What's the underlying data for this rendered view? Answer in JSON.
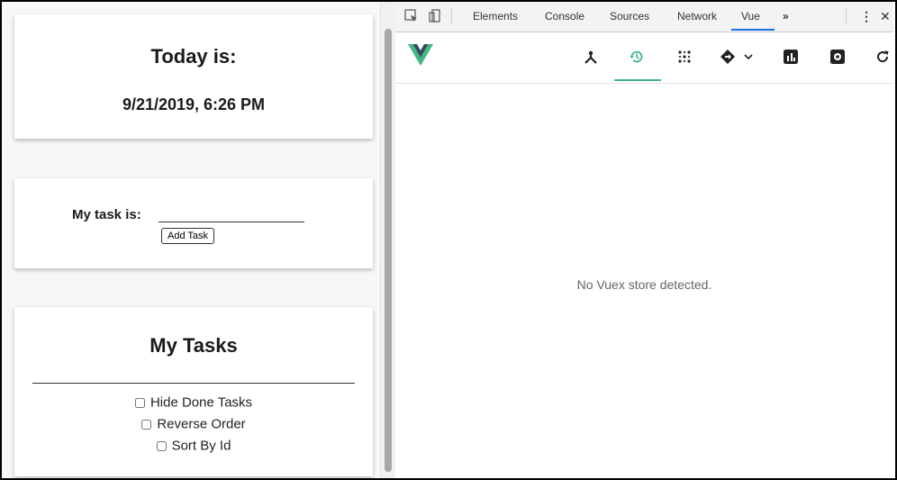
{
  "app": {
    "date_card": {
      "title": "Today is:",
      "datetime": "9/21/2019, 6:26 PM"
    },
    "task_form": {
      "label": "My task is:",
      "input_value": "",
      "add_button": "Add Task"
    },
    "task_list": {
      "title": "My Tasks",
      "options": [
        {
          "label": "Hide Done Tasks",
          "checked": false
        },
        {
          "label": "Reverse Order",
          "checked": false
        },
        {
          "label": "Sort By Id",
          "checked": false
        }
      ]
    }
  },
  "devtools": {
    "tabs": [
      "Elements",
      "Console",
      "Sources",
      "Network",
      "Vue"
    ],
    "active_tab": "Vue",
    "more_tabs_glyph": "»",
    "toolbar_icons": [
      "components-icon",
      "history-icon",
      "vuex-icon",
      "routing-icon",
      "performance-icon",
      "settings-icon",
      "refresh-icon"
    ],
    "active_toolbar_icon": "history-icon",
    "empty_message": "No Vuex store detected.",
    "accent_color": "#41b883",
    "vue_logo_colors": {
      "outer": "#41b883",
      "inner": "#35495e"
    }
  }
}
